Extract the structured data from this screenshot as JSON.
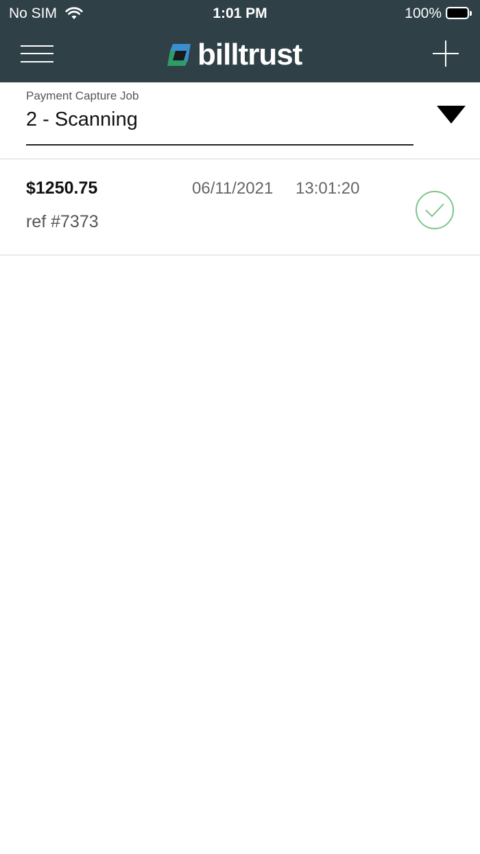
{
  "status_bar": {
    "carrier": "No SIM",
    "time": "1:01 PM",
    "battery": "100%"
  },
  "nav": {
    "brand": "billtrust",
    "menu_icon": "hamburger-menu-icon",
    "add_icon": "plus-icon"
  },
  "job_selector": {
    "label": "Payment Capture Job",
    "value": "2 - Scanning",
    "icon": "triangle-down-icon"
  },
  "payments": [
    {
      "amount": "$1250.75",
      "date": "06/11/2021",
      "time": "13:01:20",
      "ref": "ref #7373",
      "status_icon": "check-circle-icon"
    }
  ],
  "colors": {
    "header_bg": "#2f4047",
    "status_success": "#7cc58a",
    "logo_blue": "#3a8fd0",
    "logo_green": "#2f9a6a"
  }
}
